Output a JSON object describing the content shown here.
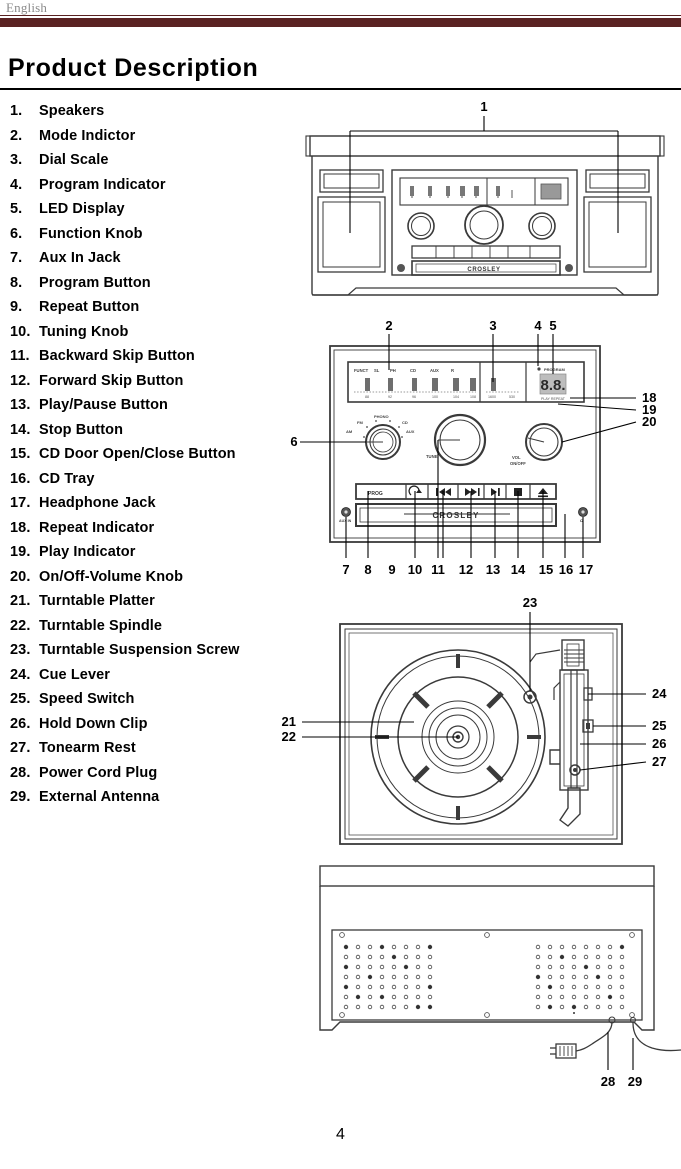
{
  "header": {
    "language": "English",
    "bar_color": "#5a2222"
  },
  "title": "Product Description",
  "page_number": "4",
  "parts_list": [
    {
      "num": "1.",
      "label": "Speakers"
    },
    {
      "num": "2.",
      "label": "Mode Indictor"
    },
    {
      "num": "3.",
      "label": "Dial Scale"
    },
    {
      "num": "4.",
      "label": "Program Indicator"
    },
    {
      "num": "5.",
      "label": "LED Display"
    },
    {
      "num": "6.",
      "label": "Function Knob"
    },
    {
      "num": "7.",
      "label": "Aux In Jack"
    },
    {
      "num": "8.",
      "label": "Program Button"
    },
    {
      "num": "9.",
      "label": "Repeat Button"
    },
    {
      "num": "10.",
      "label": "Tuning Knob"
    },
    {
      "num": "11.",
      "label": "Backward Skip Button"
    },
    {
      "num": "12.",
      "label": "Forward Skip Button"
    },
    {
      "num": "13.",
      "label": "Play/Pause Button"
    },
    {
      "num": "14.",
      "label": "Stop Button"
    },
    {
      "num": "15.",
      "label": "CD Door Open/Close Button"
    },
    {
      "num": "16.",
      "label": "CD Tray"
    },
    {
      "num": "17.",
      "label": "Headphone Jack"
    },
    {
      "num": "18.",
      "label": "Repeat Indicator"
    },
    {
      "num": "19.",
      "label": "Play Indicator"
    },
    {
      "num": "20.",
      "label": "On/Off-Volume Knob"
    },
    {
      "num": "21.",
      "label": "Turntable Platter"
    },
    {
      "num": "22.",
      "label": "Turntable Spindle"
    },
    {
      "num": "23.",
      "label": "Turntable Suspension Screw"
    },
    {
      "num": "24.",
      "label": "Cue Lever"
    },
    {
      "num": "25.",
      "label": "Speed Switch"
    },
    {
      "num": "26.",
      "label": "Hold Down Clip"
    },
    {
      "num": "27.",
      "label": "Tonearm Rest"
    },
    {
      "num": "28.",
      "label": "Power Cord Plug"
    },
    {
      "num": "29.",
      "label": "External Antenna"
    }
  ],
  "diagrams": {
    "front_view": {
      "callouts": [
        "1"
      ]
    },
    "control_panel": {
      "callouts_top": [
        "2",
        "3",
        "4",
        "5"
      ],
      "callout_left": "6",
      "callouts_right": [
        "18",
        "19",
        "20"
      ],
      "callouts_bottom": [
        "7",
        "8",
        "9",
        "10",
        "11",
        "12",
        "13",
        "14",
        "15",
        "16",
        "17"
      ],
      "mode_indicator_labels": [
        "FUNCT",
        "SL",
        "PH",
        "CD",
        "AUX",
        "R"
      ],
      "dial_scale_fm_ticks": [
        "88",
        "92",
        "96",
        "100",
        "104",
        "108"
      ],
      "dial_scale_am_ticks": [
        "530",
        "1600"
      ],
      "led_display_value": "8.8.",
      "program_label": "PROGRAM",
      "indicator_label": "PLAY  REPEAT",
      "function_knob_labels": {
        "top": "PHONO",
        "left": "FM",
        "right": "CD",
        "lower_left": "AM",
        "lower_right": "AUX"
      },
      "tuning_knob_label": "TUNE",
      "volume_knob_label": "VOL\nON/OFF",
      "buttons": [
        "PROG",
        "repeat-icon",
        "skip-back-icon",
        "skip-forward-icon",
        "play-pause-icon",
        "stop-icon",
        "eject-icon"
      ],
      "cd_tray_brand": "CROSLEY",
      "aux_jack_label": "AUX IN",
      "headphone_jack_label": "Ω"
    },
    "turntable_view": {
      "callouts_left": [
        "21",
        "22"
      ],
      "callout_top": "23",
      "callouts_right": [
        "24",
        "25",
        "26",
        "27"
      ]
    },
    "rear_view": {
      "callouts_bottom": [
        "28",
        "29"
      ]
    }
  }
}
